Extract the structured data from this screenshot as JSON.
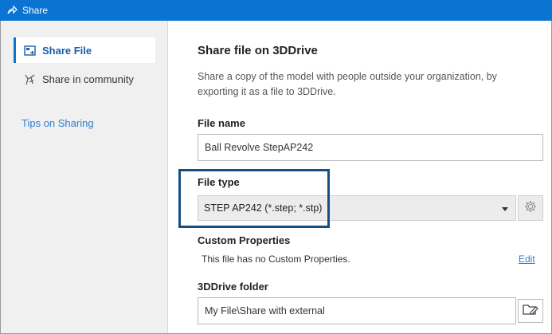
{
  "window": {
    "title": "Share",
    "accent": "#0b73d1"
  },
  "sidebar": {
    "items": [
      {
        "label": "Share File",
        "icon": "share-file-icon",
        "active": true
      },
      {
        "label": "Share in community",
        "icon": "community-icon",
        "active": false
      }
    ],
    "tips_link": "Tips on Sharing"
  },
  "main": {
    "heading": "Share file on 3DDrive",
    "description": "Share a copy of the model with people outside your organization, by exporting it as a file to 3DDrive.",
    "file_name": {
      "label": "File name",
      "value": "Ball Revolve StepAP242"
    },
    "file_type": {
      "label": "File type",
      "selected": "STEP AP242 (*.step; *.stp)",
      "settings_icon": "gear-icon"
    },
    "custom_properties": {
      "label": "Custom Properties",
      "note": "This file has no Custom Properties.",
      "edit_link": "Edit"
    },
    "folder": {
      "label": "3DDrive folder",
      "value": "My File\\Share with external",
      "browse_icon": "folder-edit-icon"
    }
  }
}
